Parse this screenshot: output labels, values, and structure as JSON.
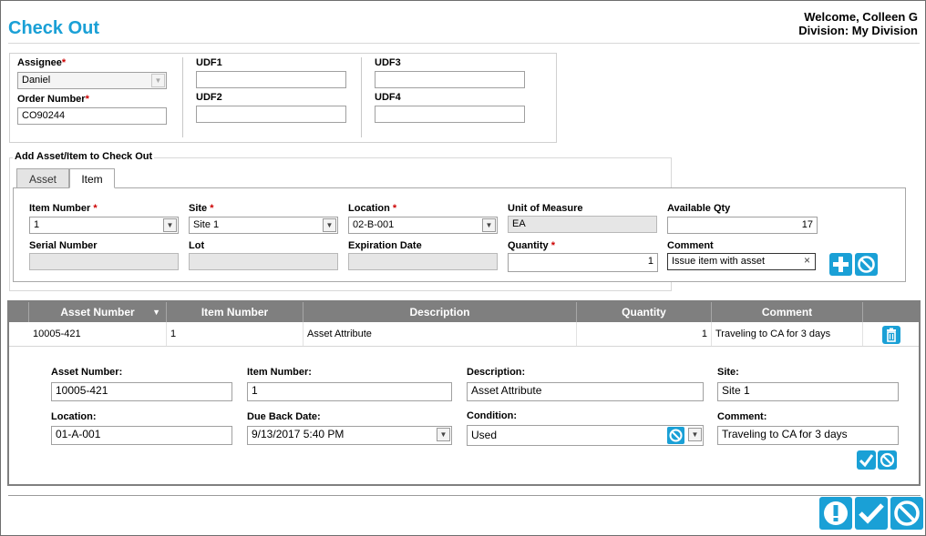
{
  "page": {
    "title": "Check Out"
  },
  "user": {
    "welcome": "Welcome, Colleen G",
    "division": "Division: My Division"
  },
  "header_form": {
    "assignee": {
      "label": "Assignee",
      "value": "Daniel"
    },
    "order_number": {
      "label": "Order Number",
      "value": "CO90244"
    },
    "udf1": {
      "label": "UDF1",
      "value": ""
    },
    "udf2": {
      "label": "UDF2",
      "value": ""
    },
    "udf3": {
      "label": "UDF3",
      "value": ""
    },
    "udf4": {
      "label": "UDF4",
      "value": ""
    }
  },
  "add_section": {
    "legend": "Add Asset/Item to Check Out",
    "tabs": [
      {
        "label": "Asset",
        "active": false
      },
      {
        "label": "Item",
        "active": true
      }
    ],
    "fields": {
      "item_number": {
        "label": "Item Number",
        "value": "1"
      },
      "site": {
        "label": "Site",
        "value": "Site 1"
      },
      "location": {
        "label": "Location",
        "value": "02-B-001"
      },
      "unit_of_measure": {
        "label": "Unit of Measure",
        "value": "EA"
      },
      "available_qty": {
        "label": "Available Qty",
        "value": "17"
      },
      "serial_number": {
        "label": "Serial Number",
        "value": ""
      },
      "lot": {
        "label": "Lot",
        "value": ""
      },
      "expiration_date": {
        "label": "Expiration Date",
        "value": ""
      },
      "quantity": {
        "label": "Quantity",
        "value": "1"
      },
      "comment": {
        "label": "Comment",
        "value": "Issue item with asset"
      }
    },
    "required_mark": "*",
    "clear_glyph": "×"
  },
  "grid": {
    "columns": [
      "Asset Number",
      "Item Number",
      "Description",
      "Quantity",
      "Comment"
    ],
    "rows": [
      {
        "asset_number": "10005-421",
        "item_number": "1",
        "description": "Asset Attribute",
        "quantity": "1",
        "comment": "Traveling to CA for 3 days"
      }
    ]
  },
  "detail": {
    "asset_number": {
      "label": "Asset Number:",
      "value": "10005-421"
    },
    "item_number": {
      "label": "Item Number:",
      "value": "1"
    },
    "description": {
      "label": "Description:",
      "value": "Asset Attribute"
    },
    "site": {
      "label": "Site:",
      "value": "Site 1"
    },
    "location": {
      "label": "Location:",
      "value": "01-A-001"
    },
    "due_back_date": {
      "label": "Due Back Date:",
      "value": "9/13/2017 5:40 PM"
    },
    "condition": {
      "label": "Condition:",
      "value": "Used"
    },
    "comment": {
      "label": "Comment:",
      "value": "Traveling to CA for 3 days"
    }
  },
  "colors": {
    "accent": "#1aa0d6",
    "required": "#cc0000",
    "grid_header": "#7f7f7f"
  },
  "icons": [
    "chevron-down-icon",
    "plus-icon",
    "cancel-icon",
    "trash-icon",
    "check-icon",
    "exclamation-icon",
    "sort-down-icon"
  ]
}
